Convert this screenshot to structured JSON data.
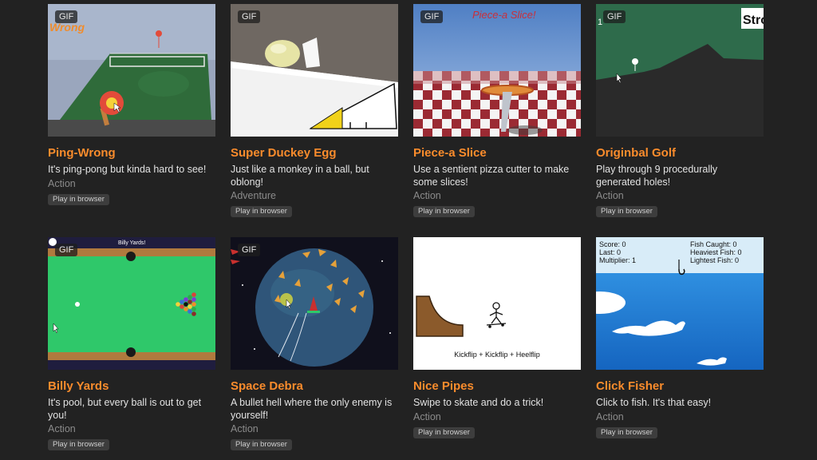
{
  "badge": "GIF",
  "games": [
    {
      "title": "Ping-Wrong",
      "desc": "It's ping-pong but kinda hard to see!",
      "genre": "Action",
      "play": "Play in browser",
      "thumb_text": "Wrong"
    },
    {
      "title": "Super Duckey Egg",
      "desc": "Just like a monkey in a ball, but oblong!",
      "genre": "Adventure",
      "play": "Play in browser"
    },
    {
      "title": "Piece-a Slice",
      "desc": "Use a sentient pizza cutter to make some slices!",
      "genre": "Action",
      "play": "Play in browser",
      "thumb_text": "Piece-a Slice!"
    },
    {
      "title": "Originbal Golf",
      "desc": "Play through 9 procedurally generated holes!",
      "genre": "Action",
      "play": "Play in browser",
      "thumb_text": "Stro",
      "hole": "1"
    },
    {
      "title": "Billy Yards",
      "desc": "It's pool, but every ball is out to get you!",
      "genre": "Action",
      "play": "Play in browser",
      "thumb_text": "Billy Yards!"
    },
    {
      "title": "Space Debra",
      "desc": "A bullet hell where the only enemy is yourself!",
      "genre": "Action",
      "play": "Play in browser"
    },
    {
      "title": "Nice Pipes",
      "desc": "Swipe to skate and do a trick!",
      "genre": "Action",
      "play": "Play in browser",
      "thumb_text": "Kickflip + Kickflip + Heelflip"
    },
    {
      "title": "Click Fisher",
      "desc": "Click to fish. It's that easy!",
      "genre": "Action",
      "play": "Play in browser",
      "hud": {
        "score": "Score: 0",
        "last": "Last: 0",
        "multiplier": "Multiplier: 1",
        "caught": "Fish Caught: 0",
        "heaviest": "Heaviest Fish: 0",
        "lightest": "Lightest Fish: 0"
      }
    }
  ]
}
